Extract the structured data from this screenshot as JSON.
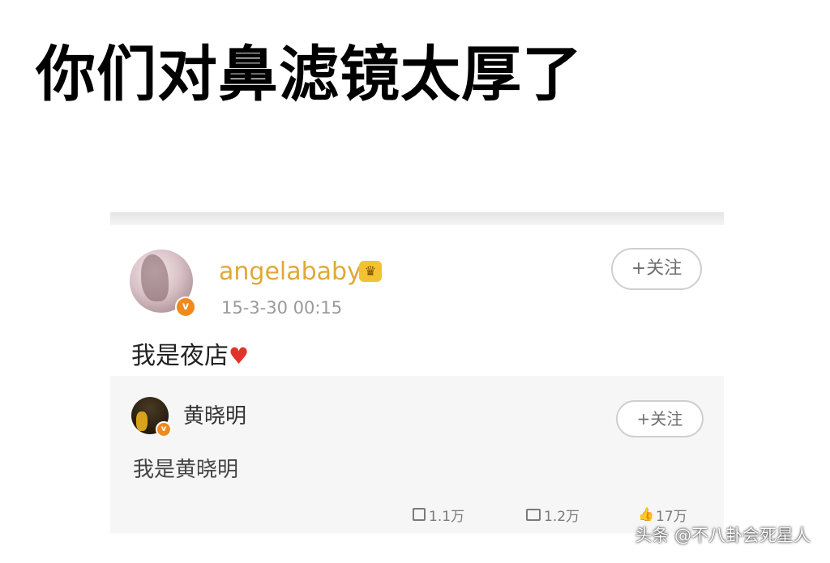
{
  "headline": "你们对鼻滤镜太厚了",
  "post": {
    "username": "angelababy",
    "timestamp": "15-3-30 00:15",
    "follow_label": "+关注",
    "text": "我是夜店",
    "verified_badge": "v",
    "crown_icon": "crown-icon",
    "heart_icon": "heart-icon"
  },
  "repost": {
    "username": "黄晓明",
    "follow_label": "+关注",
    "text": "我是黄晓明",
    "verified_badge": "v"
  },
  "stats": {
    "reposts": "1.1万",
    "comments": "1.2万",
    "likes": "17万"
  },
  "watermark": "头条 @不八卦会死星人",
  "colors": {
    "username": "#e0a83a",
    "verified": "#f28a1b",
    "heart": "#e0342b"
  }
}
